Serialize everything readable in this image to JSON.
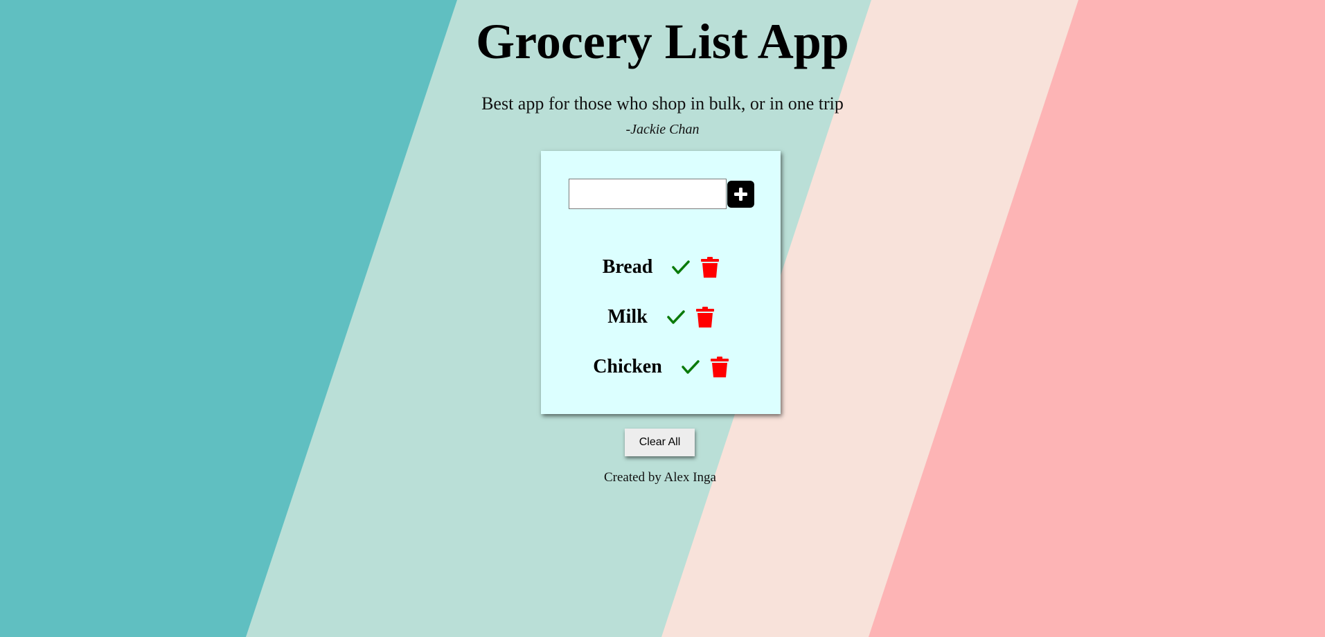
{
  "header": {
    "title": "Grocery List App",
    "subtitle": "Best app for those who shop in bulk, or in one trip",
    "author": "-Jackie Chan"
  },
  "form": {
    "input_value": "",
    "add_icon": "plus-icon"
  },
  "items": [
    {
      "name": "Bread",
      "check_icon": "checkmark-icon",
      "delete_icon": "trash-icon"
    },
    {
      "name": "Milk",
      "check_icon": "checkmark-icon",
      "delete_icon": "trash-icon"
    },
    {
      "name": "Chicken",
      "check_icon": "checkmark-icon",
      "delete_icon": "trash-icon"
    }
  ],
  "actions": {
    "clear_label": "Clear All"
  },
  "footer": {
    "text": "Created by Alex Inga"
  },
  "colors": {
    "teal": "#60bfc1",
    "mint": "#badfd7",
    "peach": "#f8e2da",
    "pink": "#fdb4b5",
    "card_background": "#dcffff",
    "check": "#0a7a0a",
    "trash": "#ff0000",
    "add_button": "#000000"
  }
}
